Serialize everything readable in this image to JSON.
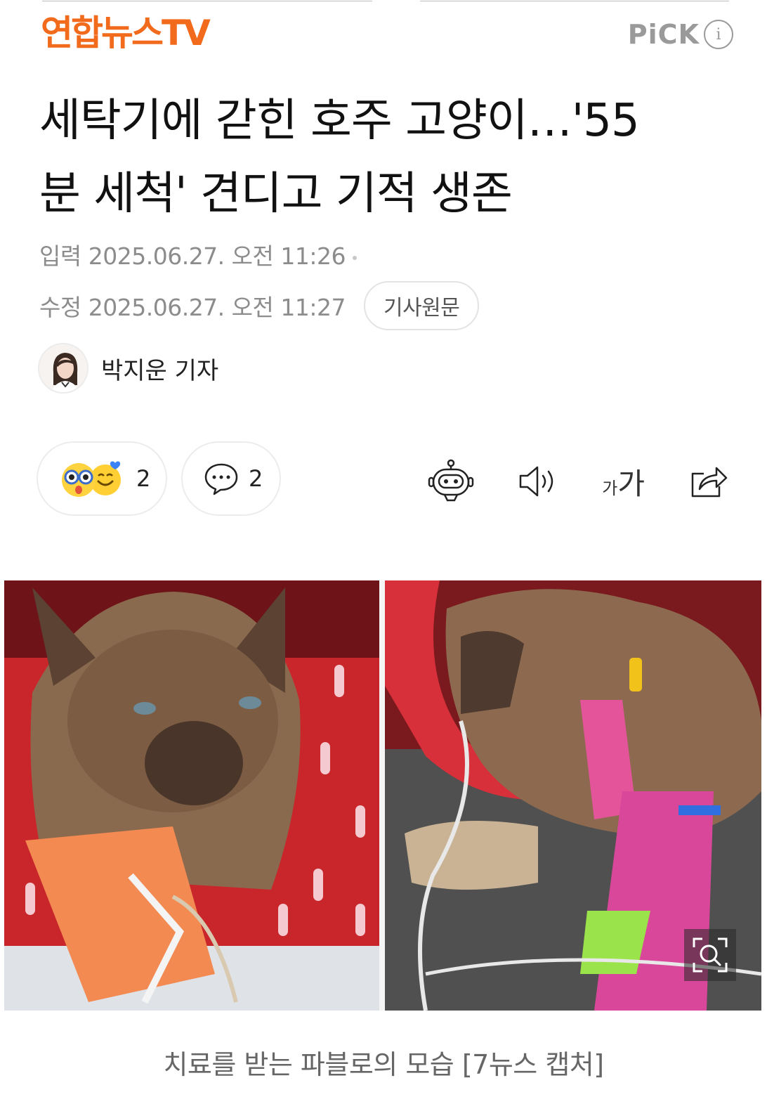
{
  "header": {
    "press_name": "연합뉴스TV",
    "pick_label": "PiCK",
    "info_icon": "info-icon"
  },
  "article": {
    "headline_line1": "세탁기에 갇힌 호주 고양이…'55",
    "headline_line2": "분 세척' 견디고 기적 생존",
    "input_label": "입력",
    "input_datetime": "2025.06.27. 오전 11:26",
    "edit_label": "수정",
    "edit_datetime": "2025.06.27. 오전 11:27",
    "original_button": "기사원문"
  },
  "reporter": {
    "name": "박지운 기자"
  },
  "actions": {
    "reaction_count": "2",
    "comment_count": "2",
    "icons": [
      "surprised-face-icon",
      "smile-face-icon",
      "comment-icon",
      "summary-bot-icon",
      "speaker-icon",
      "font-size-icon",
      "share-icon"
    ],
    "font_small": "가",
    "font_large": "가"
  },
  "photo": {
    "caption": "치료를 받는 파블로의 모습 [7뉴스 캡처]",
    "zoom_icon": "zoom-icon"
  },
  "colors": {
    "brand": "#f26b1d",
    "meta_text": "#8c8c8c",
    "divider": "#ececec"
  }
}
